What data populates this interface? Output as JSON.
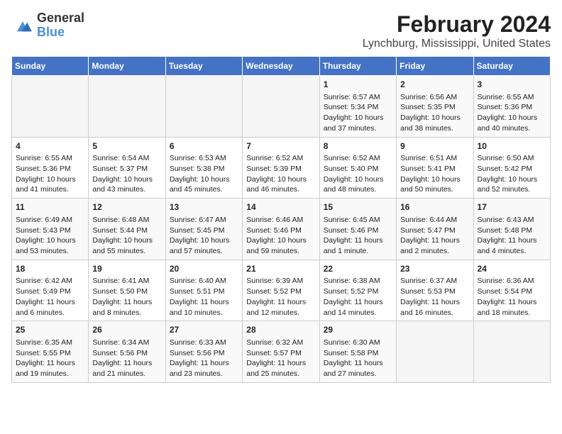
{
  "logo": {
    "line1": "General",
    "line2": "Blue"
  },
  "title": "February 2024",
  "subtitle": "Lynchburg, Mississippi, United States",
  "days_of_week": [
    "Sunday",
    "Monday",
    "Tuesday",
    "Wednesday",
    "Thursday",
    "Friday",
    "Saturday"
  ],
  "weeks": [
    [
      {
        "day": "",
        "info": ""
      },
      {
        "day": "",
        "info": ""
      },
      {
        "day": "",
        "info": ""
      },
      {
        "day": "",
        "info": ""
      },
      {
        "day": "1",
        "info": "Sunrise: 6:57 AM\nSunset: 5:34 PM\nDaylight: 10 hours\nand 37 minutes."
      },
      {
        "day": "2",
        "info": "Sunrise: 6:56 AM\nSunset: 5:35 PM\nDaylight: 10 hours\nand 38 minutes."
      },
      {
        "day": "3",
        "info": "Sunrise: 6:55 AM\nSunset: 5:36 PM\nDaylight: 10 hours\nand 40 minutes."
      }
    ],
    [
      {
        "day": "4",
        "info": "Sunrise: 6:55 AM\nSunset: 5:36 PM\nDaylight: 10 hours\nand 41 minutes."
      },
      {
        "day": "5",
        "info": "Sunrise: 6:54 AM\nSunset: 5:37 PM\nDaylight: 10 hours\nand 43 minutes."
      },
      {
        "day": "6",
        "info": "Sunrise: 6:53 AM\nSunset: 5:38 PM\nDaylight: 10 hours\nand 45 minutes."
      },
      {
        "day": "7",
        "info": "Sunrise: 6:52 AM\nSunset: 5:39 PM\nDaylight: 10 hours\nand 46 minutes."
      },
      {
        "day": "8",
        "info": "Sunrise: 6:52 AM\nSunset: 5:40 PM\nDaylight: 10 hours\nand 48 minutes."
      },
      {
        "day": "9",
        "info": "Sunrise: 6:51 AM\nSunset: 5:41 PM\nDaylight: 10 hours\nand 50 minutes."
      },
      {
        "day": "10",
        "info": "Sunrise: 6:50 AM\nSunset: 5:42 PM\nDaylight: 10 hours\nand 52 minutes."
      }
    ],
    [
      {
        "day": "11",
        "info": "Sunrise: 6:49 AM\nSunset: 5:43 PM\nDaylight: 10 hours\nand 53 minutes."
      },
      {
        "day": "12",
        "info": "Sunrise: 6:48 AM\nSunset: 5:44 PM\nDaylight: 10 hours\nand 55 minutes."
      },
      {
        "day": "13",
        "info": "Sunrise: 6:47 AM\nSunset: 5:45 PM\nDaylight: 10 hours\nand 57 minutes."
      },
      {
        "day": "14",
        "info": "Sunrise: 6:46 AM\nSunset: 5:46 PM\nDaylight: 10 hours\nand 59 minutes."
      },
      {
        "day": "15",
        "info": "Sunrise: 6:45 AM\nSunset: 5:46 PM\nDaylight: 11 hours\nand 1 minute."
      },
      {
        "day": "16",
        "info": "Sunrise: 6:44 AM\nSunset: 5:47 PM\nDaylight: 11 hours\nand 2 minutes."
      },
      {
        "day": "17",
        "info": "Sunrise: 6:43 AM\nSunset: 5:48 PM\nDaylight: 11 hours\nand 4 minutes."
      }
    ],
    [
      {
        "day": "18",
        "info": "Sunrise: 6:42 AM\nSunset: 5:49 PM\nDaylight: 11 hours\nand 6 minutes."
      },
      {
        "day": "19",
        "info": "Sunrise: 6:41 AM\nSunset: 5:50 PM\nDaylight: 11 hours\nand 8 minutes."
      },
      {
        "day": "20",
        "info": "Sunrise: 6:40 AM\nSunset: 5:51 PM\nDaylight: 11 hours\nand 10 minutes."
      },
      {
        "day": "21",
        "info": "Sunrise: 6:39 AM\nSunset: 5:52 PM\nDaylight: 11 hours\nand 12 minutes."
      },
      {
        "day": "22",
        "info": "Sunrise: 6:38 AM\nSunset: 5:52 PM\nDaylight: 11 hours\nand 14 minutes."
      },
      {
        "day": "23",
        "info": "Sunrise: 6:37 AM\nSunset: 5:53 PM\nDaylight: 11 hours\nand 16 minutes."
      },
      {
        "day": "24",
        "info": "Sunrise: 6:36 AM\nSunset: 5:54 PM\nDaylight: 11 hours\nand 18 minutes."
      }
    ],
    [
      {
        "day": "25",
        "info": "Sunrise: 6:35 AM\nSunset: 5:55 PM\nDaylight: 11 hours\nand 19 minutes."
      },
      {
        "day": "26",
        "info": "Sunrise: 6:34 AM\nSunset: 5:56 PM\nDaylight: 11 hours\nand 21 minutes."
      },
      {
        "day": "27",
        "info": "Sunrise: 6:33 AM\nSunset: 5:56 PM\nDaylight: 11 hours\nand 23 minutes."
      },
      {
        "day": "28",
        "info": "Sunrise: 6:32 AM\nSunset: 5:57 PM\nDaylight: 11 hours\nand 25 minutes."
      },
      {
        "day": "29",
        "info": "Sunrise: 6:30 AM\nSunset: 5:58 PM\nDaylight: 11 hours\nand 27 minutes."
      },
      {
        "day": "",
        "info": ""
      },
      {
        "day": "",
        "info": ""
      }
    ]
  ]
}
